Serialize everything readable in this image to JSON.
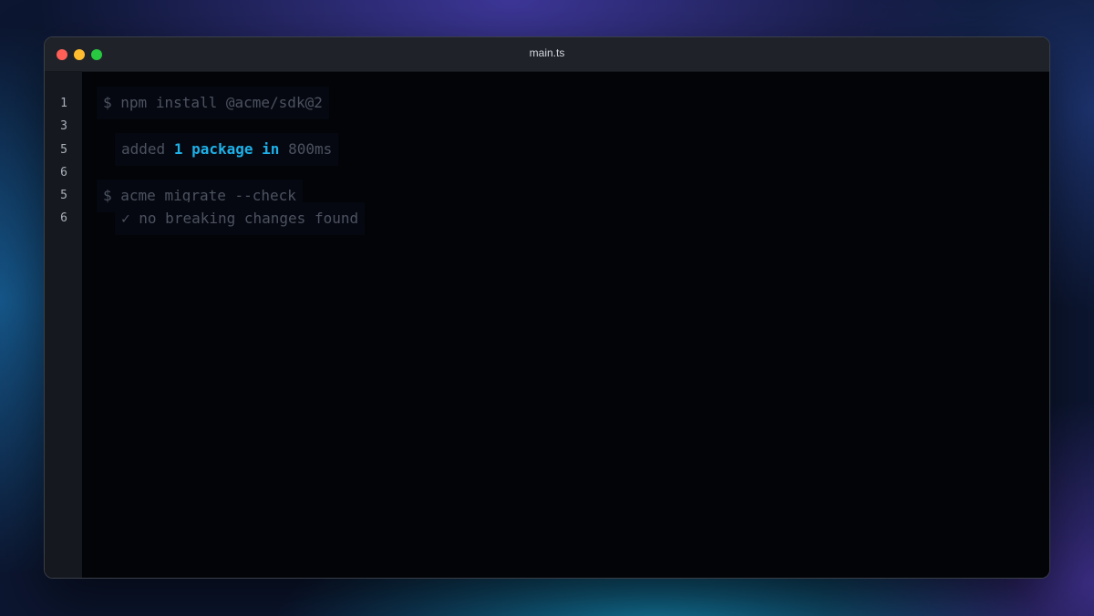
{
  "window": {
    "title": "main.ts",
    "controls": [
      "close",
      "minimize",
      "zoom"
    ]
  },
  "colors": {
    "accent": "#1eb0e8",
    "muted_text": "#4c5260",
    "editor_background": "#020408",
    "titlebar": "#1f2329"
  },
  "gutter": {
    "line_numbers": [
      "1",
      "3",
      "5",
      "6",
      "5",
      "6"
    ]
  },
  "terminal": {
    "line1": {
      "prompt": "$",
      "command": "npm install @acme/sdk@2"
    },
    "line2": {
      "word_added": "added",
      "count": "1",
      "word_package": "package",
      "word_in": "in",
      "duration": "800ms"
    },
    "line3": {
      "prompt": "$",
      "command": "acme migrate --check"
    },
    "line4": {
      "check": "✓",
      "message": "no breaking changes found"
    }
  }
}
